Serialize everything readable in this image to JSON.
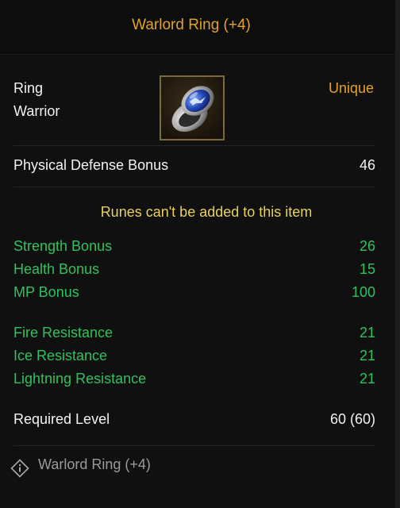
{
  "item": {
    "title": "Warlord Ring (+4)",
    "type": "Ring",
    "class": "Warrior",
    "rarity": "Unique",
    "icon": "warlord-ring-icon"
  },
  "defense": {
    "label": "Physical Defense Bonus",
    "value": "46"
  },
  "rune_note": "Runes can't be added to this item",
  "bonuses": [
    {
      "label": "Strength Bonus",
      "value": "26"
    },
    {
      "label": "Health Bonus",
      "value": "15"
    },
    {
      "label": "MP Bonus",
      "value": "100"
    }
  ],
  "resistances": [
    {
      "label": "Fire Resistance",
      "value": "21"
    },
    {
      "label": "Ice Resistance",
      "value": "21"
    },
    {
      "label": "Lightning Resistance",
      "value": "21"
    }
  ],
  "requirement": {
    "label": "Required Level",
    "value": "60 (60)"
  },
  "footer": {
    "icon": "diamond-info-icon",
    "name": "Warlord Ring (+4)"
  },
  "colors": {
    "title": "#e2a227",
    "rarity": "#e2a227",
    "stat_green": "#2fc25c",
    "rune_note": "#e8d25a",
    "footer_text": "#9a9a9a"
  }
}
